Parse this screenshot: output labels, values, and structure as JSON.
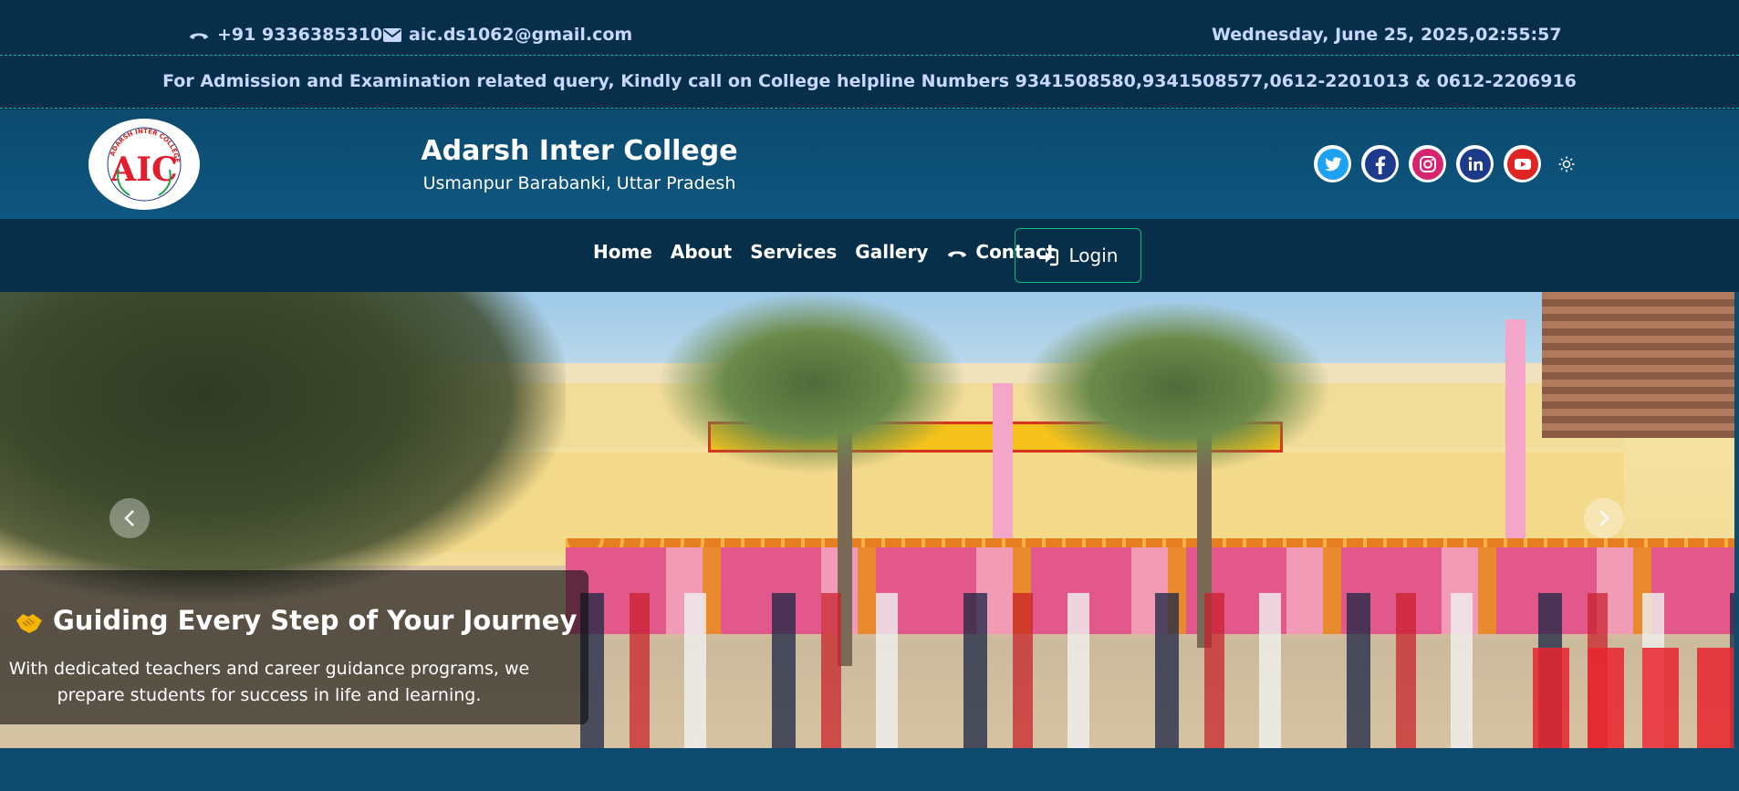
{
  "topbar": {
    "phone": "+91 9336385310",
    "email": "aic.ds1062@gmail.com",
    "datetime": "Wednesday, June 25, 2025,02:55:57",
    "notice": "For Admission and Examination related query, Kindly call on College helpline Numbers 9341508580,9341508577,0612-2201013 & 0612-2206916"
  },
  "header": {
    "logo_text": "ADARSH INTER COLLEGE",
    "logo_initials": "AIC",
    "college_name": "Adarsh Inter College",
    "location": "Usmanpur Barabanki, Uttar Pradesh",
    "socials": [
      {
        "name": "twitter-icon",
        "color": "#1da1f2"
      },
      {
        "name": "facebook-icon",
        "color": "#1877f2"
      },
      {
        "name": "instagram-icon",
        "color": "#e1306c"
      },
      {
        "name": "linkedin-icon",
        "color": "#0a66c2"
      },
      {
        "name": "youtube-icon",
        "color": "#e02424"
      }
    ],
    "theme_icon": "sun-icon"
  },
  "nav": {
    "items": [
      "Home",
      "About",
      "Services",
      "Gallery",
      "Contact"
    ],
    "login": "Login"
  },
  "hero": {
    "caption_title": "Guiding Every Step of Your Journey",
    "caption_text": "With dedicated teachers and career guidance programs, we prepare students for success in life and learning."
  },
  "colors": {
    "topbar_bg": "#082f49",
    "header_bg": "#0c4a6e",
    "accent_dashed": "#14b8a6",
    "login_border": "#10b981"
  }
}
